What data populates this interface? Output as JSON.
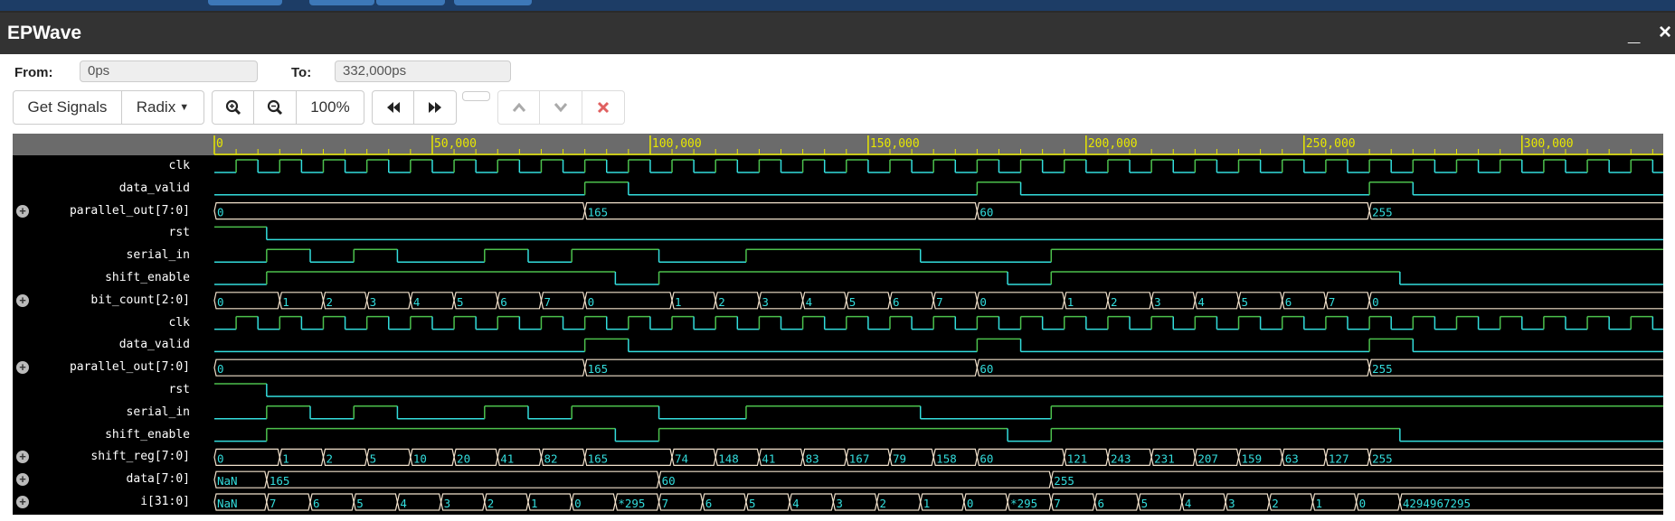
{
  "window": {
    "title": "EPWave",
    "minimize_icon": "minimize-icon",
    "close_icon": "close-icon"
  },
  "range": {
    "from_label": "From:",
    "from_value": "0ps",
    "to_label": "To:",
    "to_value": "332,000ps"
  },
  "toolbar": {
    "get_signals": "Get Signals",
    "radix": "Radix",
    "zoom_in_icon": "zoom-in-icon",
    "zoom_out_icon": "zoom-out-icon",
    "zoom_level": "100%",
    "prev_icon": "fast-backward-icon",
    "next_icon": "fast-forward-icon",
    "up_icon": "chevron-up-icon",
    "down_icon": "chevron-down-icon",
    "remove_icon": "remove-icon"
  },
  "colors": {
    "high": "#4cc04c",
    "low": "#33dddd",
    "bus": "#f2e2cc",
    "bus_text": "#33dddd",
    "ruler": "#e8e800",
    "ruler_bg": "#6b6b6b",
    "remove": "#e05050"
  },
  "chart_data": {
    "type": "waveform",
    "time_unit": "ps",
    "xlim": [
      0,
      332000
    ],
    "ruler_labels": [
      "0",
      "50,000",
      "100,000",
      "150,000",
      "200,000",
      "250,000",
      "300,000"
    ],
    "ruler_label_values": [
      0,
      50000,
      100000,
      150000,
      200000,
      250000,
      300000
    ],
    "minor_tick_step": 5000,
    "signals": [
      {
        "name": "clk",
        "kind": "clock",
        "period": 10000,
        "first_rise": 5000
      },
      {
        "name": "data_valid",
        "kind": "bit",
        "events": [
          [
            0,
            0
          ],
          [
            85000,
            1
          ],
          [
            95000,
            0
          ],
          [
            175000,
            1
          ],
          [
            185000,
            0
          ],
          [
            265000,
            1
          ],
          [
            275000,
            0
          ]
        ]
      },
      {
        "name": "parallel_out[7:0]",
        "kind": "bus",
        "events": [
          [
            0,
            "0"
          ],
          [
            85000,
            "165"
          ],
          [
            175000,
            "60"
          ],
          [
            265000,
            "255"
          ]
        ]
      },
      {
        "name": "rst",
        "kind": "bit",
        "events": [
          [
            0,
            1
          ],
          [
            12000,
            0
          ]
        ]
      },
      {
        "name": "serial_in",
        "kind": "bit",
        "events": [
          [
            0,
            0
          ],
          [
            12000,
            1
          ],
          [
            22000,
            0
          ],
          [
            32000,
            1
          ],
          [
            42000,
            0
          ],
          [
            62000,
            1
          ],
          [
            72000,
            0
          ],
          [
            82000,
            1
          ],
          [
            102000,
            0
          ],
          [
            122000,
            1
          ],
          [
            162000,
            0
          ],
          [
            192000,
            1
          ]
        ]
      },
      {
        "name": "shift_enable",
        "kind": "bit",
        "events": [
          [
            0,
            0
          ],
          [
            12000,
            1
          ],
          [
            92000,
            0
          ],
          [
            102000,
            1
          ],
          [
            182000,
            0
          ],
          [
            192000,
            1
          ],
          [
            272000,
            0
          ]
        ]
      },
      {
        "name": "bit_count[2:0]",
        "kind": "bus",
        "events": [
          [
            0,
            "0"
          ],
          [
            15000,
            "1"
          ],
          [
            25000,
            "2"
          ],
          [
            35000,
            "3"
          ],
          [
            45000,
            "4"
          ],
          [
            55000,
            "5"
          ],
          [
            65000,
            "6"
          ],
          [
            75000,
            "7"
          ],
          [
            85000,
            "0"
          ],
          [
            105000,
            "1"
          ],
          [
            115000,
            "2"
          ],
          [
            125000,
            "3"
          ],
          [
            135000,
            "4"
          ],
          [
            145000,
            "5"
          ],
          [
            155000,
            "6"
          ],
          [
            165000,
            "7"
          ],
          [
            175000,
            "0"
          ],
          [
            195000,
            "1"
          ],
          [
            205000,
            "2"
          ],
          [
            215000,
            "3"
          ],
          [
            225000,
            "4"
          ],
          [
            235000,
            "5"
          ],
          [
            245000,
            "6"
          ],
          [
            255000,
            "7"
          ],
          [
            265000,
            "0"
          ]
        ]
      },
      {
        "name": "clk",
        "kind": "clock",
        "period": 10000,
        "first_rise": 5000
      },
      {
        "name": "data_valid",
        "kind": "bit",
        "events": [
          [
            0,
            0
          ],
          [
            85000,
            1
          ],
          [
            95000,
            0
          ],
          [
            175000,
            1
          ],
          [
            185000,
            0
          ],
          [
            265000,
            1
          ],
          [
            275000,
            0
          ]
        ]
      },
      {
        "name": "parallel_out[7:0]",
        "kind": "bus",
        "events": [
          [
            0,
            "0"
          ],
          [
            85000,
            "165"
          ],
          [
            175000,
            "60"
          ],
          [
            265000,
            "255"
          ]
        ]
      },
      {
        "name": "rst",
        "kind": "bit",
        "events": [
          [
            0,
            1
          ],
          [
            12000,
            0
          ]
        ]
      },
      {
        "name": "serial_in",
        "kind": "bit",
        "events": [
          [
            0,
            0
          ],
          [
            12000,
            1
          ],
          [
            22000,
            0
          ],
          [
            32000,
            1
          ],
          [
            42000,
            0
          ],
          [
            62000,
            1
          ],
          [
            72000,
            0
          ],
          [
            82000,
            1
          ],
          [
            102000,
            0
          ],
          [
            122000,
            1
          ],
          [
            162000,
            0
          ],
          [
            192000,
            1
          ]
        ]
      },
      {
        "name": "shift_enable",
        "kind": "bit",
        "events": [
          [
            0,
            0
          ],
          [
            12000,
            1
          ],
          [
            92000,
            0
          ],
          [
            102000,
            1
          ],
          [
            182000,
            0
          ],
          [
            192000,
            1
          ],
          [
            272000,
            0
          ]
        ]
      },
      {
        "name": "shift_reg[7:0]",
        "kind": "bus",
        "events": [
          [
            0,
            "0"
          ],
          [
            15000,
            "1"
          ],
          [
            25000,
            "2"
          ],
          [
            35000,
            "5"
          ],
          [
            45000,
            "10"
          ],
          [
            55000,
            "20"
          ],
          [
            65000,
            "41"
          ],
          [
            75000,
            "82"
          ],
          [
            85000,
            "165"
          ],
          [
            105000,
            "74"
          ],
          [
            115000,
            "148"
          ],
          [
            125000,
            "41"
          ],
          [
            135000,
            "83"
          ],
          [
            145000,
            "167"
          ],
          [
            155000,
            "79"
          ],
          [
            165000,
            "158"
          ],
          [
            175000,
            "60"
          ],
          [
            195000,
            "121"
          ],
          [
            205000,
            "243"
          ],
          [
            215000,
            "231"
          ],
          [
            225000,
            "207"
          ],
          [
            235000,
            "159"
          ],
          [
            245000,
            "63"
          ],
          [
            255000,
            "127"
          ],
          [
            265000,
            "255"
          ]
        ]
      },
      {
        "name": "data[7:0]",
        "kind": "bus",
        "events": [
          [
            0,
            "NaN"
          ],
          [
            12000,
            "165"
          ],
          [
            102000,
            "60"
          ],
          [
            192000,
            "255"
          ]
        ]
      },
      {
        "name": "i[31:0]",
        "kind": "bus",
        "events": [
          [
            0,
            "NaN"
          ],
          [
            12000,
            "7"
          ],
          [
            22000,
            "6"
          ],
          [
            32000,
            "5"
          ],
          [
            42000,
            "4"
          ],
          [
            52000,
            "3"
          ],
          [
            62000,
            "2"
          ],
          [
            72000,
            "1"
          ],
          [
            82000,
            "0"
          ],
          [
            92000,
            "*295"
          ],
          [
            102000,
            "7"
          ],
          [
            112000,
            "6"
          ],
          [
            122000,
            "5"
          ],
          [
            132000,
            "4"
          ],
          [
            142000,
            "3"
          ],
          [
            152000,
            "2"
          ],
          [
            162000,
            "1"
          ],
          [
            172000,
            "0"
          ],
          [
            182000,
            "*295"
          ],
          [
            192000,
            "7"
          ],
          [
            202000,
            "6"
          ],
          [
            212000,
            "5"
          ],
          [
            222000,
            "4"
          ],
          [
            232000,
            "3"
          ],
          [
            242000,
            "2"
          ],
          [
            252000,
            "1"
          ],
          [
            262000,
            "0"
          ],
          [
            272000,
            "4294967295"
          ]
        ]
      }
    ]
  }
}
